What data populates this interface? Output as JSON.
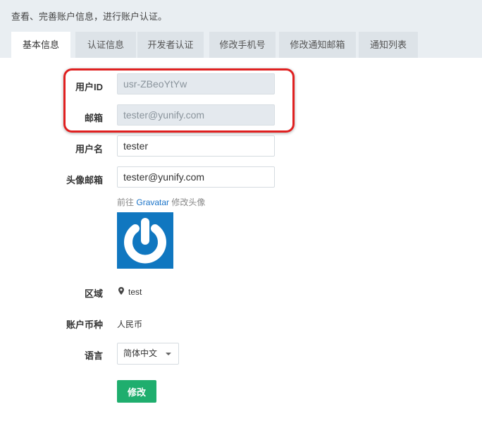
{
  "header": {
    "subtitle": "查看、完善账户信息，进行账户认证。"
  },
  "tabs": [
    {
      "label": "基本信息",
      "active": true
    },
    {
      "label": "认证信息",
      "active": false
    },
    {
      "label": "开发者认证",
      "active": false
    },
    {
      "label": "修改手机号",
      "active": false
    },
    {
      "label": "修改通知邮箱",
      "active": false
    },
    {
      "label": "通知列表",
      "active": false
    }
  ],
  "form": {
    "user_id_label": "用户ID",
    "user_id_value": "usr-ZBeoYtYw",
    "email_label": "邮箱",
    "email_value": "tester@yunify.com",
    "username_label": "用户名",
    "username_value": "tester",
    "avatar_email_label": "头像邮箱",
    "avatar_email_value": "tester@yunify.com",
    "gravatar_prefix": "前往",
    "gravatar_link": "Gravatar",
    "gravatar_suffix": "修改头像",
    "zone_label": "区域",
    "zone_value": "test",
    "currency_label": "账户币种",
    "currency_value": "人民币",
    "language_label": "语言",
    "language_value": "简体中文",
    "submit_label": "修改"
  },
  "colors": {
    "accent_green": "#1fae6e",
    "link_blue": "#1a73c8",
    "highlight_red": "#e02020",
    "avatar_blue": "#1077c0"
  }
}
